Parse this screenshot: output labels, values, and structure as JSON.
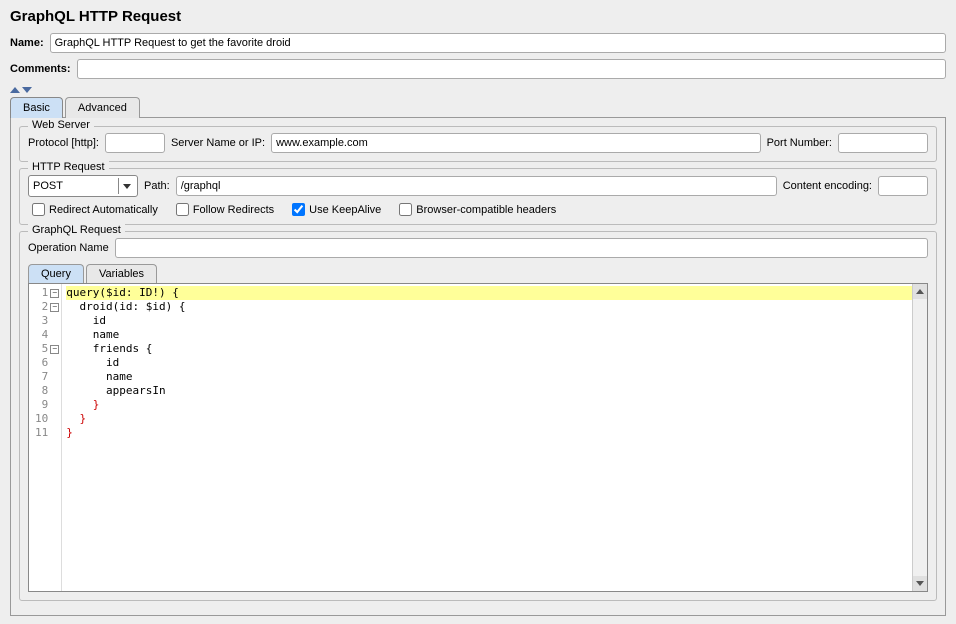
{
  "header": {
    "title": "GraphQL HTTP Request",
    "name_label": "Name:",
    "name_value": "GraphQL HTTP Request to get the favorite droid",
    "comments_label": "Comments:",
    "comments_value": ""
  },
  "tabs": {
    "basic": "Basic",
    "advanced": "Advanced"
  },
  "webserver": {
    "legend": "Web Server",
    "protocol_label": "Protocol [http]:",
    "protocol_value": "",
    "server_label": "Server Name or IP:",
    "server_value": "www.example.com",
    "port_label": "Port Number:",
    "port_value": ""
  },
  "httprequest": {
    "legend": "HTTP Request",
    "method": "POST",
    "path_label": "Path:",
    "path_value": "/graphql",
    "encoding_label": "Content encoding:",
    "encoding_value": "",
    "redirect_auto": "Redirect Automatically",
    "follow_redirects": "Follow Redirects",
    "keepalive": "Use KeepAlive",
    "browser_headers": "Browser-compatible headers"
  },
  "graphql": {
    "legend": "GraphQL Request",
    "opname_label": "Operation Name",
    "opname_value": "",
    "tab_query": "Query",
    "tab_variables": "Variables",
    "lines": [
      "query($id: ID!) {",
      "  droid(id: $id) {",
      "    id",
      "    name",
      "    friends {",
      "      id",
      "      name",
      "      appearsIn",
      "    }",
      "  }",
      "}"
    ]
  }
}
